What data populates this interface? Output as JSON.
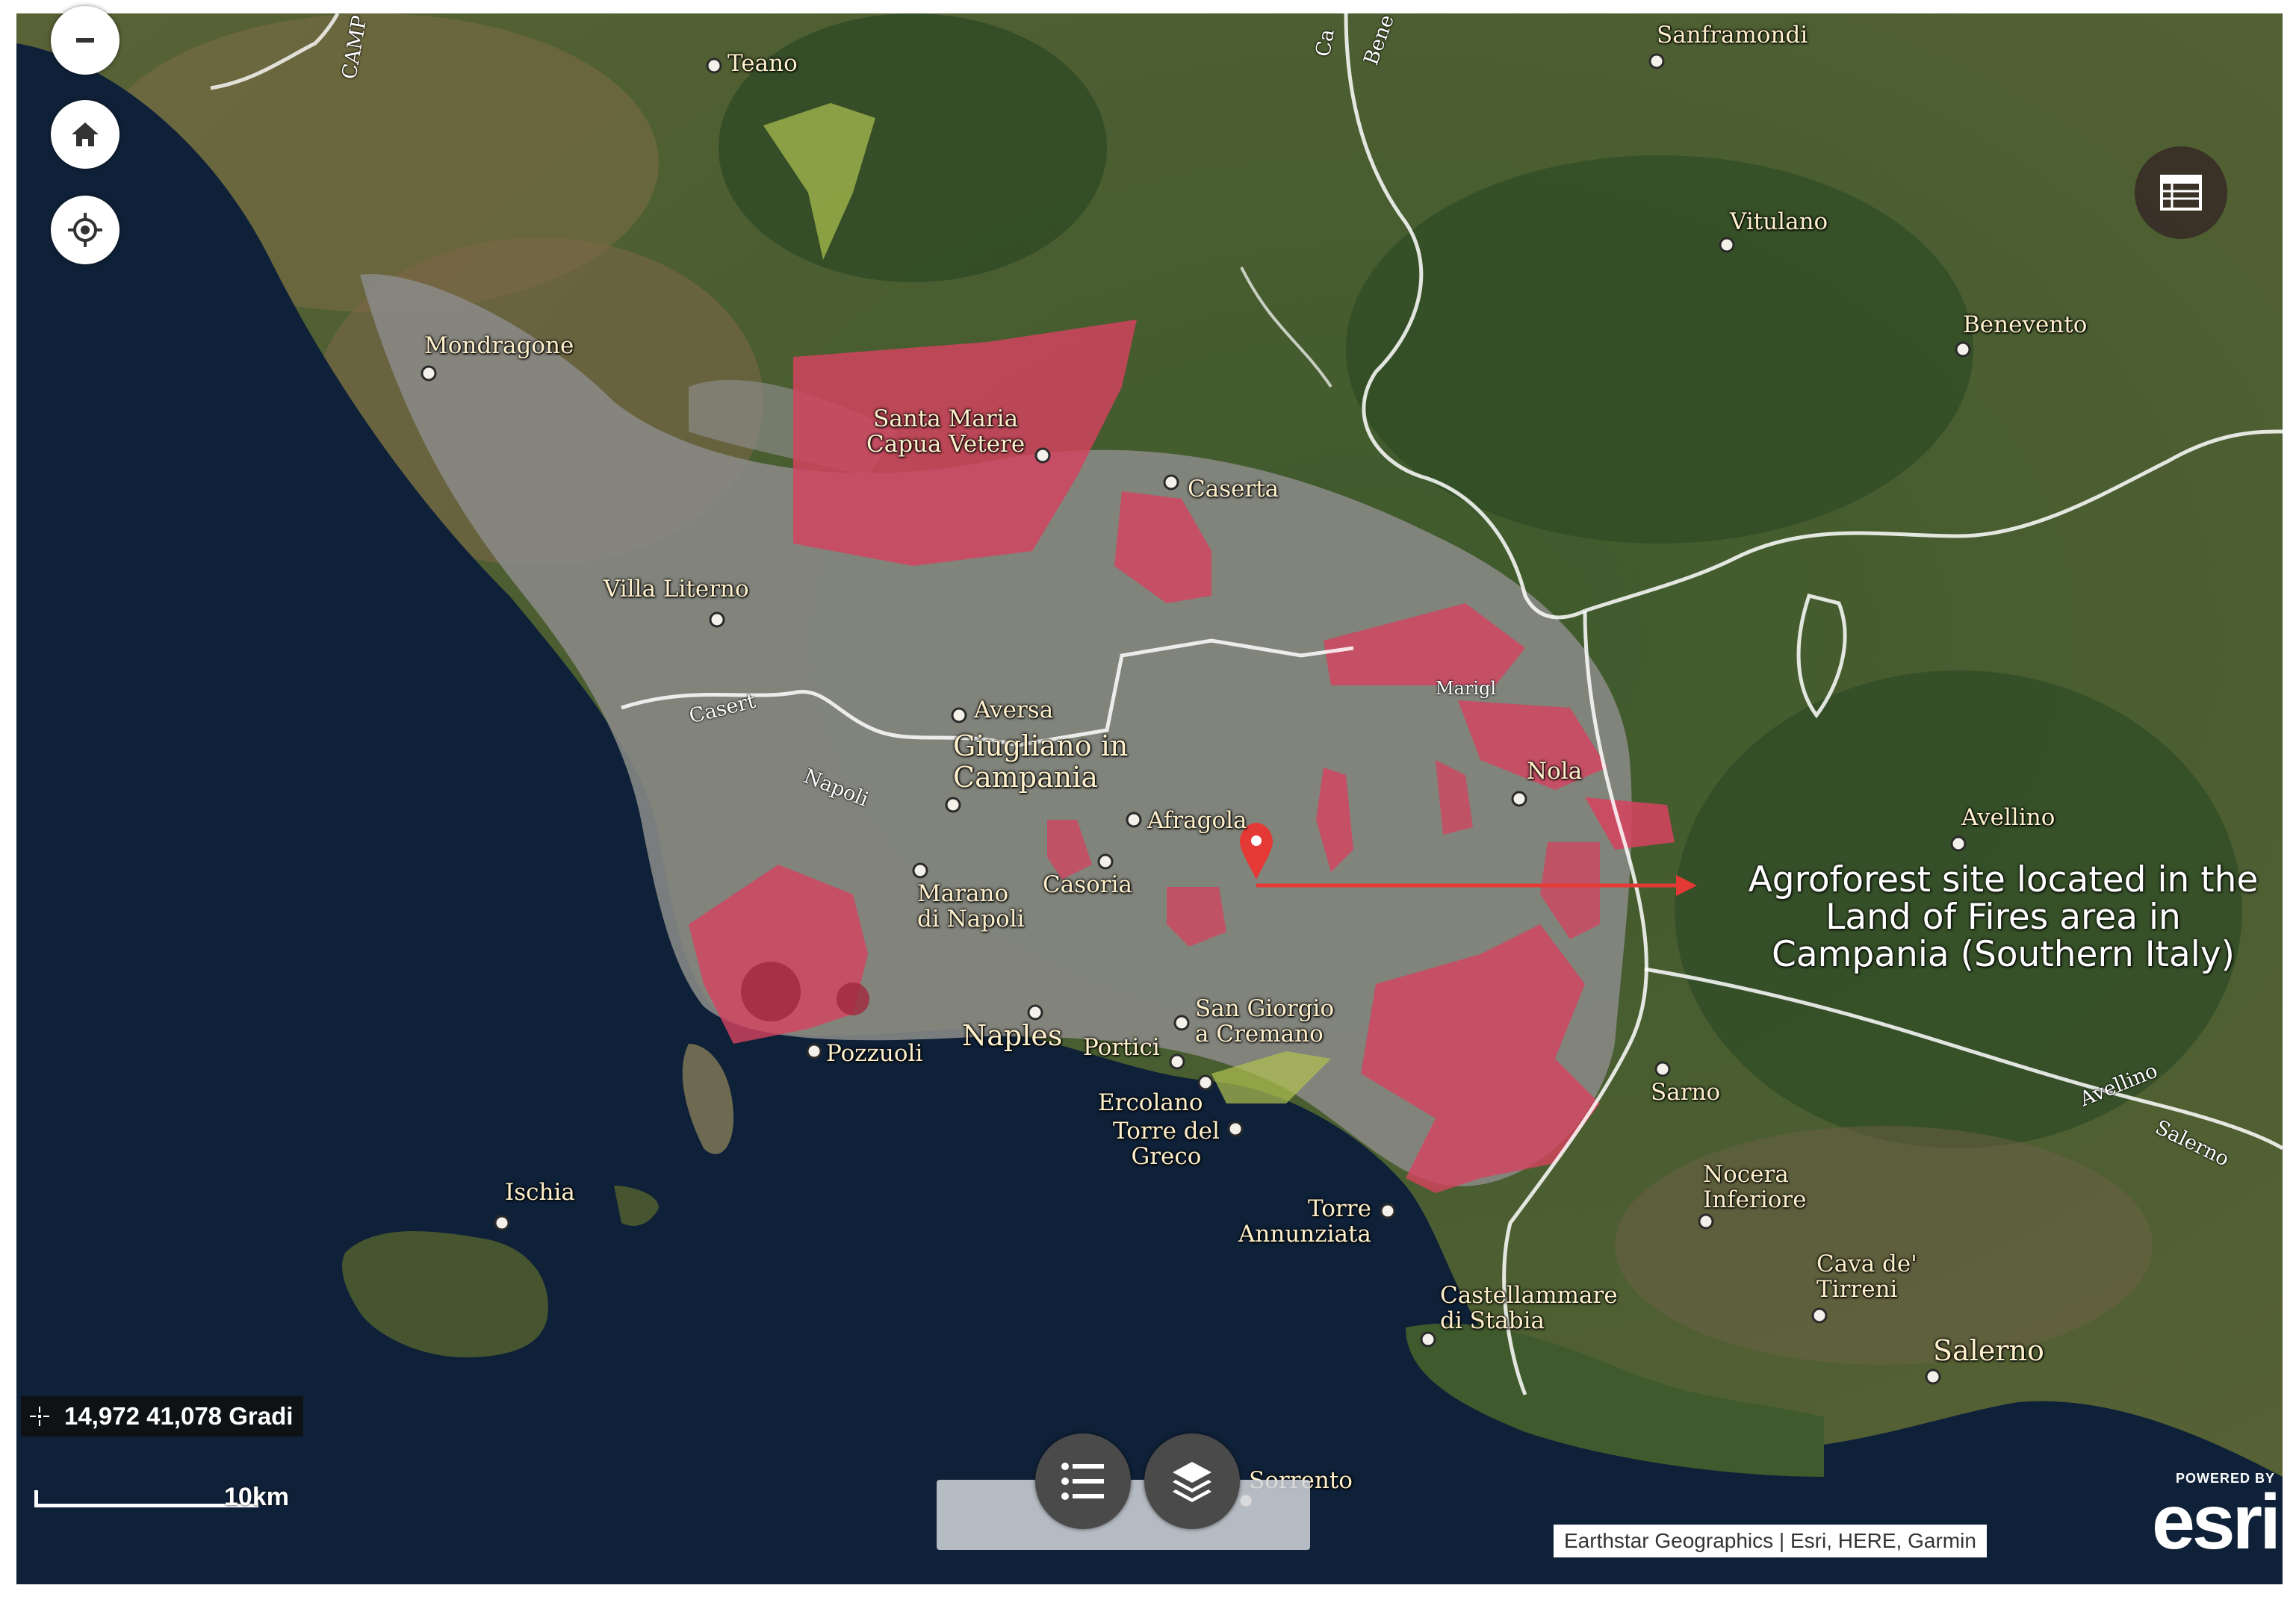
{
  "map": {
    "basemap_colors": {
      "sea": "#0f2138",
      "land": "#4b5a33",
      "urban": "#8a8a86",
      "highlight": "#d6425f",
      "border": "#ffffff",
      "pin": "#e53935"
    }
  },
  "controls": {
    "zoom_out_icon": "minus-icon",
    "home_icon": "home-icon",
    "locate_icon": "locate-icon",
    "legend_icon": "table-list-icon",
    "list_icon": "list-icon",
    "layers_icon": "layers-icon"
  },
  "coordinates": {
    "text": "14,972 41,078 Gradi"
  },
  "scale": {
    "label": "10km"
  },
  "attribution": "Earthstar Geographics | Esri, HERE, Garmin",
  "esri": {
    "powered": "POWERED BY",
    "logo": "esri"
  },
  "annotation": {
    "line1": "Agroforest  site located in the",
    "line2": "Land of Fires area in",
    "line3": "Campania (Southern Italy)"
  },
  "places": [
    {
      "name": "Teano"
    },
    {
      "name": "Sanframondi"
    },
    {
      "name": "Vitulano"
    },
    {
      "name": "Benevento"
    },
    {
      "name": "Mondragone"
    },
    {
      "name": "Santa Maria\nCapua Vetere"
    },
    {
      "name": "Caserta"
    },
    {
      "name": "Villa Literno"
    },
    {
      "name": "Aversa"
    },
    {
      "name": "Giugliano in\nCampania"
    },
    {
      "name": "Afragola"
    },
    {
      "name": "Nola"
    },
    {
      "name": "Avellino"
    },
    {
      "name": "Marano\ndi Napoli"
    },
    {
      "name": "Casoria"
    },
    {
      "name": "Naples"
    },
    {
      "name": "Pozzuoli"
    },
    {
      "name": "Portici"
    },
    {
      "name": "San Giorgio\na Cremano"
    },
    {
      "name": "Ercolano"
    },
    {
      "name": "Torre del\nGreco"
    },
    {
      "name": "Sarno"
    },
    {
      "name": "Torre\nAnnunziata"
    },
    {
      "name": "Nocera\nInferiore"
    },
    {
      "name": "Cava de'\nTirreni"
    },
    {
      "name": "Ischia"
    },
    {
      "name": "Castellammare\ndi Stabia"
    },
    {
      "name": "Salerno"
    },
    {
      "name": "Sorrento"
    }
  ],
  "roads": [
    {
      "name": "Casert"
    },
    {
      "name": "Napoli"
    },
    {
      "name": "Avellino"
    },
    {
      "name": "Salerno"
    },
    {
      "name": "Bene"
    },
    {
      "name": "CAMP"
    },
    {
      "name": "Ca"
    },
    {
      "name": "Marigl"
    }
  ]
}
